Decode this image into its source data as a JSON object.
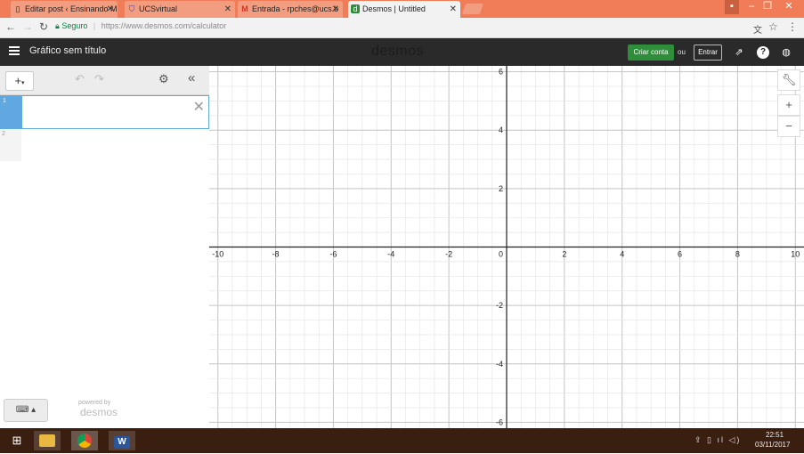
{
  "browser": {
    "tabs": [
      {
        "title": "Editar post ‹ Ensinando M",
        "icon": "blogger-icon",
        "active": false
      },
      {
        "title": "UCSvirtual",
        "icon": "shield-icon",
        "active": false
      },
      {
        "title": "Entrada - rpches@ucs.b",
        "icon": "gmail-icon",
        "active": false
      },
      {
        "title": "Desmos | Untitled",
        "icon": "desmos-icon",
        "active": true
      }
    ],
    "window_controls": {
      "minimize": "–",
      "maximize": "❐",
      "close": "✕"
    },
    "address": {
      "secure_label": "Seguro",
      "url": "https://www.desmos.com/calculator"
    }
  },
  "desmos": {
    "graph_title": "Gráfico sem título",
    "brand": "desmos",
    "create_account": "Criar conta",
    "or": "ou",
    "login": "Entrar",
    "expressions": [
      {
        "index": "1",
        "value": ""
      },
      {
        "index": "2",
        "value": ""
      }
    ],
    "powered_by": "powered by",
    "powered_logo": "desmos"
  },
  "graph": {
    "x_range": [
      -10.3,
      10.3
    ],
    "y_range": [
      -6.2,
      6.2
    ],
    "x_ticks": [
      "-10",
      "-8",
      "-6",
      "-4",
      "-2",
      "0",
      "2",
      "4",
      "6",
      "8",
      "10"
    ],
    "y_ticks": [
      "6",
      "4",
      "2",
      "-2",
      "-4",
      "-6"
    ],
    "grid": true,
    "colors": {
      "minor_grid": "#e6e6e6",
      "major_grid": "#c4c4c4",
      "axis": "#222222"
    }
  },
  "taskbar": {
    "time": "22:51",
    "date": "03/11/2017",
    "apps": [
      "file-explorer-icon",
      "chrome-icon",
      "word-icon"
    ],
    "tray": "⇪ ▯ ıl ◁)"
  }
}
